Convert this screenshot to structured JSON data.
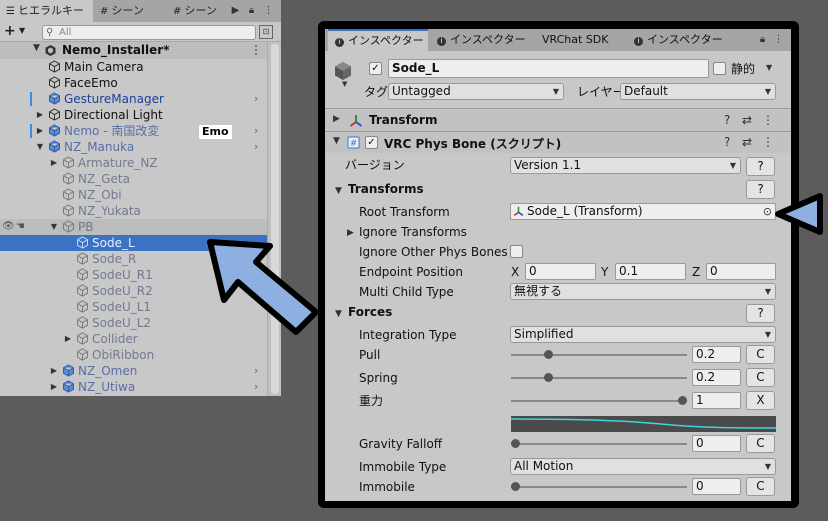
{
  "hierarchy": {
    "tabs": [
      {
        "label": "ヒエラルキー",
        "icon": "list-icon",
        "active": true
      },
      {
        "label": "シーン",
        "icon": "hash-icon",
        "active": false
      },
      {
        "label": "シーン",
        "icon": "hash-icon",
        "active": false
      }
    ],
    "search_placeholder": "All",
    "scene_name": "Nemo_Installer*",
    "items": [
      {
        "label": "Main Camera",
        "depth": 1,
        "style": "normal",
        "arrow": "",
        "chev": false,
        "marker": false
      },
      {
        "label": "FaceEmo",
        "depth": 1,
        "style": "normal",
        "arrow": "",
        "chev": false,
        "marker": false
      },
      {
        "label": "GestureManager",
        "depth": 1,
        "style": "blue",
        "arrow": "",
        "chev": true,
        "marker": true
      },
      {
        "label": "Directional Light",
        "depth": 1,
        "style": "normal",
        "arrow": "▶",
        "chev": false,
        "marker": false
      },
      {
        "label": "Nemo - 南国改変",
        "depth": 1,
        "style": "blue-dim",
        "arrow": "▶",
        "chev": true,
        "marker": true
      },
      {
        "label": "NZ_Manuka",
        "depth": 1,
        "style": "blue-dim",
        "arrow": "▼",
        "chev": true,
        "marker": false
      },
      {
        "label": "Armature_NZ",
        "depth": 2,
        "style": "dim",
        "arrow": "▶",
        "chev": false,
        "marker": false
      },
      {
        "label": "NZ_Geta",
        "depth": 2,
        "style": "dim",
        "arrow": "",
        "chev": false,
        "marker": false
      },
      {
        "label": "NZ_Obi",
        "depth": 2,
        "style": "dim",
        "arrow": "",
        "chev": false,
        "marker": false
      },
      {
        "label": "NZ_Yukata",
        "depth": 2,
        "style": "dim",
        "arrow": "",
        "chev": false,
        "marker": false
      },
      {
        "label": "PB",
        "depth": 2,
        "style": "dim",
        "arrow": "▼",
        "chev": false,
        "marker": false,
        "pb": true
      },
      {
        "label": "Sode_L",
        "depth": 3,
        "style": "selected",
        "arrow": "",
        "chev": false,
        "marker": false
      },
      {
        "label": "Sode_R",
        "depth": 3,
        "style": "dim",
        "arrow": "",
        "chev": false,
        "marker": false
      },
      {
        "label": "SodeU_R1",
        "depth": 3,
        "style": "dim",
        "arrow": "",
        "chev": false,
        "marker": false
      },
      {
        "label": "SodeU_R2",
        "depth": 3,
        "style": "dim",
        "arrow": "",
        "chev": false,
        "marker": false
      },
      {
        "label": "SodeU_L1",
        "depth": 3,
        "style": "dim",
        "arrow": "",
        "chev": false,
        "marker": false
      },
      {
        "label": "SodeU_L2",
        "depth": 3,
        "style": "dim",
        "arrow": "",
        "chev": false,
        "marker": false
      },
      {
        "label": "Collider",
        "depth": 3,
        "style": "dim",
        "arrow": "▶",
        "chev": false,
        "marker": false
      },
      {
        "label": "ObiRibbon",
        "depth": 3,
        "style": "dim",
        "arrow": "",
        "chev": false,
        "marker": false
      },
      {
        "label": "NZ_Omen",
        "depth": 2,
        "style": "blue-dim",
        "arrow": "▶",
        "chev": true,
        "marker": false
      },
      {
        "label": "NZ_Utiwa",
        "depth": 2,
        "style": "blue-dim",
        "arrow": "▶",
        "chev": true,
        "marker": false
      }
    ],
    "emo_badge": "Emo"
  },
  "inspector": {
    "tabs": [
      {
        "label": "インスペクター",
        "active": true
      },
      {
        "label": "インスペクター",
        "active": false
      },
      {
        "label": "VRChat SDK",
        "active": false
      },
      {
        "label": "インスペクター",
        "active": false
      }
    ],
    "object": {
      "name": "Sode_L",
      "static_label": "静的",
      "tag_label": "タグ",
      "tag_value": "Untagged",
      "layer_label": "レイヤー",
      "layer_value": "Default"
    },
    "transform_title": "Transform",
    "physbone_title": "VRC Phys Bone (スクリプト)",
    "version_label": "バージョン",
    "version_value": "Version 1.1",
    "help": "?",
    "transforms_section": "Transforms",
    "root_transform_label": "Root Transform",
    "root_transform_value": "Sode_L (Transform)",
    "ignore_transforms_label": "Ignore Transforms",
    "ignore_other_label": "Ignore Other Phys Bones",
    "endpoint_label": "Endpoint Position",
    "endpoint": {
      "x_label": "X",
      "x": "0",
      "y_label": "Y",
      "y": "0.1",
      "z_label": "Z",
      "z": "0"
    },
    "multi_child_label": "Multi Child Type",
    "multi_child_value": "無視する",
    "forces_section": "Forces",
    "integration_label": "Integration Type",
    "integration_value": "Simplified",
    "pull_label": "Pull",
    "pull_value": "0.2",
    "pull_fraction": 0.2,
    "pull_btn": "C",
    "spring_label": "Spring",
    "spring_value": "0.2",
    "spring_fraction": 0.2,
    "spring_btn": "C",
    "gravity_label": "重力",
    "gravity_value": "1",
    "gravity_fraction": 1.0,
    "gravity_btn": "X",
    "gravity_falloff_label": "Gravity Falloff",
    "gravity_falloff_value": "0",
    "gravity_falloff_fraction": 0.0,
    "gravity_falloff_btn": "C",
    "immobile_type_label": "Immobile Type",
    "immobile_type_value": "All Motion",
    "immobile_label": "Immobile",
    "immobile_value": "0",
    "immobile_fraction": 0.0,
    "immobile_btn": "C"
  },
  "colors": {
    "selection": "#3a72c4",
    "annotation_arrow": "#8eb0e0",
    "curve": "#3fd6df"
  }
}
